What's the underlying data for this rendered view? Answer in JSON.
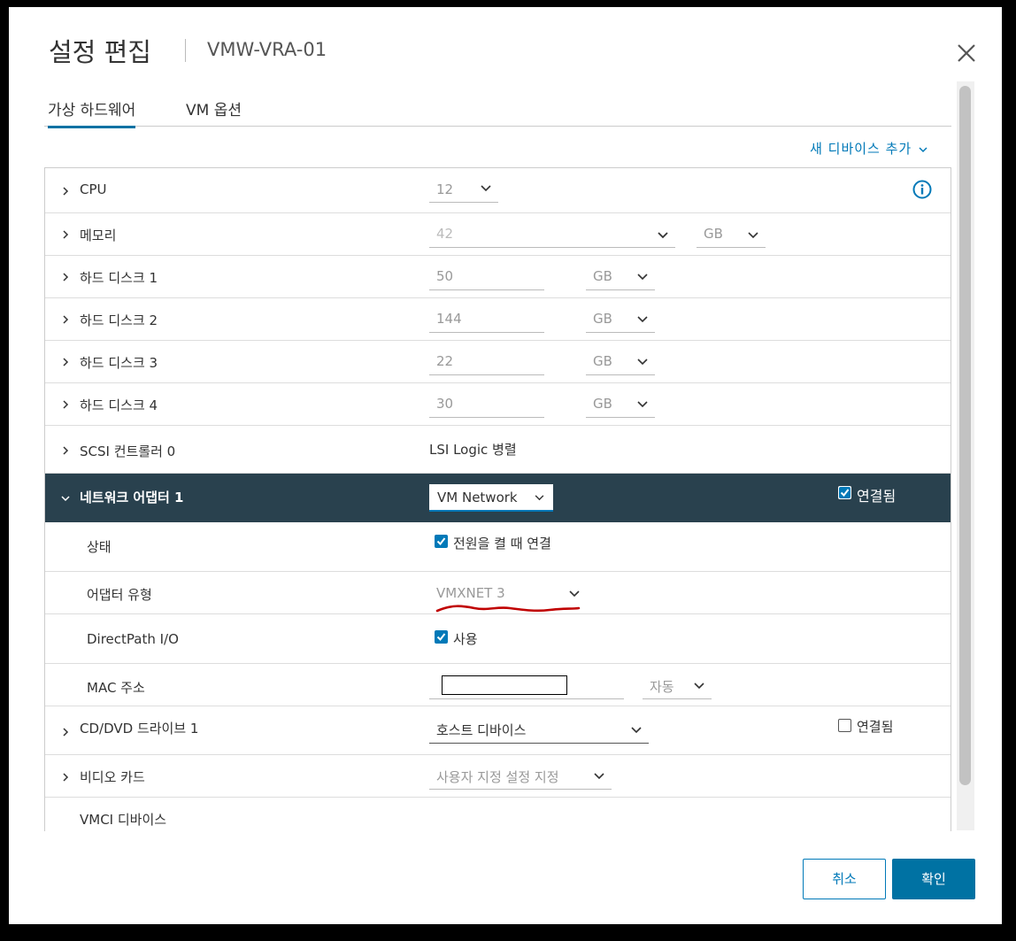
{
  "dialog": {
    "title": "설정 편집",
    "vm_name": "VMW-VRA-01"
  },
  "tabs": [
    {
      "label": "가상 하드웨어"
    },
    {
      "label": "VM 옵션"
    }
  ],
  "add_device": "새 디바이스 추가",
  "rows": {
    "cpu": {
      "label": "CPU",
      "value": "12"
    },
    "memory": {
      "label": "메모리",
      "value": "42",
      "unit": "GB"
    },
    "disk1": {
      "label": "하드 디스크 1",
      "value": "50",
      "unit": "GB"
    },
    "disk2": {
      "label": "하드 디스크 2",
      "value": "144",
      "unit": "GB"
    },
    "disk3": {
      "label": "하드 디스크 3",
      "value": "22",
      "unit": "GB"
    },
    "disk4": {
      "label": "하드 디스크 4",
      "value": "30",
      "unit": "GB"
    },
    "scsi": {
      "label": "SCSI 컨트롤러 0",
      "value": "LSI Logic 병렬"
    },
    "network": {
      "label": "네트워크 어댑터 1",
      "value": "VM Network",
      "connected_label": "연결됨",
      "connected": true
    },
    "status": {
      "label": "상태",
      "checkbox_label": "전원을 켤 때 연결",
      "checked": true
    },
    "adapter_type": {
      "label": "어댑터 유형",
      "value": "VMXNET 3"
    },
    "directpath": {
      "label": "DirectPath I/O",
      "checkbox_label": "사용",
      "checked": true
    },
    "mac": {
      "label": "MAC 주소",
      "value": "",
      "mode": "자동"
    },
    "cddvd": {
      "label": "CD/DVD 드라이브 1",
      "value": "호스트 디바이스",
      "connected_label": "연결됨",
      "connected": false
    },
    "video": {
      "label": "비디오 카드",
      "value": "사용자 지정 설정 지정"
    },
    "vmci": {
      "label": "VMCI 디바이스"
    }
  },
  "buttons": {
    "cancel": "취소",
    "ok": "확인"
  },
  "colors": {
    "accent": "#0079b8",
    "selected_row": "#29414e",
    "annotation": "#c00000"
  }
}
